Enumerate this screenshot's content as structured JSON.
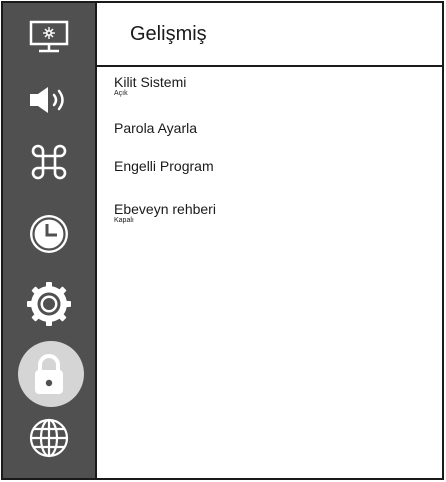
{
  "header": {
    "title": "Gelişmiş"
  },
  "sidebar": {
    "items": [
      {
        "icon": "monitor-icon",
        "active": false
      },
      {
        "icon": "speaker-icon",
        "active": false
      },
      {
        "icon": "command-icon",
        "active": false
      },
      {
        "icon": "clock-icon",
        "active": false
      },
      {
        "icon": "gear-icon",
        "active": false
      },
      {
        "icon": "lock-icon",
        "active": true
      },
      {
        "icon": "globe-icon",
        "active": false
      }
    ]
  },
  "menu": {
    "items": [
      {
        "label": "Kilit Sistemi",
        "value": "Açık"
      },
      {
        "label": "Parola Ayarla"
      },
      {
        "label": "Engelli Program"
      },
      {
        "label": "Ebeveyn rehberi",
        "value": "Kapalı"
      }
    ]
  },
  "colors": {
    "sidebar_bg": "#505050",
    "active_bubble": "#d5d5d5",
    "border": "#1a1a1a",
    "content_bg": "#ffffff"
  }
}
